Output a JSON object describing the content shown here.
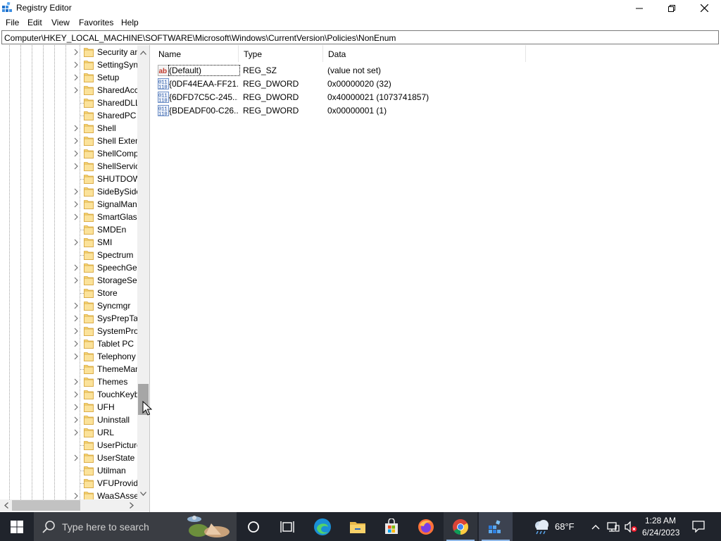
{
  "window": {
    "title": "Registry Editor",
    "app_icon": "registry-editor-icon"
  },
  "menu": [
    "File",
    "Edit",
    "View",
    "Favorites",
    "Help"
  ],
  "address": "Computer\\HKEY_LOCAL_MACHINE\\SOFTWARE\\Microsoft\\Windows\\CurrentVersion\\Policies\\NonEnum",
  "tree": {
    "items": [
      {
        "label": "Security and Maintenance",
        "expandable": true
      },
      {
        "label": "SettingSync",
        "expandable": true
      },
      {
        "label": "Setup",
        "expandable": true
      },
      {
        "label": "SharedAccess",
        "expandable": true
      },
      {
        "label": "SharedDLLs",
        "expandable": false
      },
      {
        "label": "SharedPC",
        "expandable": false
      },
      {
        "label": "Shell",
        "expandable": true
      },
      {
        "label": "Shell Extensions",
        "expandable": true
      },
      {
        "label": "ShellCompatibility",
        "expandable": true
      },
      {
        "label": "ShellServiceObjectDelayLoad",
        "expandable": true
      },
      {
        "label": "SHUTDOWN",
        "expandable": false
      },
      {
        "label": "SideBySide",
        "expandable": true
      },
      {
        "label": "SignalManager",
        "expandable": true
      },
      {
        "label": "SmartGlass",
        "expandable": true
      },
      {
        "label": "SMDEn",
        "expandable": false
      },
      {
        "label": "SMI",
        "expandable": true
      },
      {
        "label": "Spectrum",
        "expandable": false
      },
      {
        "label": "SpeechGestures",
        "expandable": true
      },
      {
        "label": "StorageSense",
        "expandable": true
      },
      {
        "label": "Store",
        "expandable": false
      },
      {
        "label": "Syncmgr",
        "expandable": true
      },
      {
        "label": "SysPrepTapi",
        "expandable": true
      },
      {
        "label": "SystemProtectedUserData",
        "expandable": true
      },
      {
        "label": "Tablet PC",
        "expandable": true
      },
      {
        "label": "Telephony",
        "expandable": true
      },
      {
        "label": "ThemeManager",
        "expandable": false
      },
      {
        "label": "Themes",
        "expandable": true
      },
      {
        "label": "TouchKeyboard",
        "expandable": true
      },
      {
        "label": "UFH",
        "expandable": true
      },
      {
        "label": "Uninstall",
        "expandable": true
      },
      {
        "label": "URL",
        "expandable": true
      },
      {
        "label": "UserPictureChange",
        "expandable": false
      },
      {
        "label": "UserState",
        "expandable": true
      },
      {
        "label": "Utilman",
        "expandable": false
      },
      {
        "label": "VFUProvider",
        "expandable": false
      },
      {
        "label": "WaaSAssessment",
        "expandable": true
      }
    ]
  },
  "columns": {
    "name": "Name",
    "type": "Type",
    "data": "Data"
  },
  "values": [
    {
      "name": "(Default)",
      "type": "REG_SZ",
      "data": "(value not set)",
      "icon": "string-value-icon"
    },
    {
      "name": "{0DF44EAA-FF21...",
      "type": "REG_DWORD",
      "data": "0x00000020 (32)",
      "icon": "binary-value-icon"
    },
    {
      "name": "{6DFD7C5C-245...",
      "type": "REG_DWORD",
      "data": "0x40000021 (1073741857)",
      "icon": "binary-value-icon"
    },
    {
      "name": "{BDEADF00-C26...",
      "type": "REG_DWORD",
      "data": "0x00000001 (1)",
      "icon": "binary-value-icon"
    }
  ],
  "taskbar": {
    "search_placeholder": "Type here to search",
    "weather": "68°F",
    "time": "1:28 AM",
    "date": "6/24/2023",
    "colors": {
      "background": "#20242c",
      "search_box": "#3a3d43",
      "active_indicator": "#8fb8e8"
    }
  }
}
